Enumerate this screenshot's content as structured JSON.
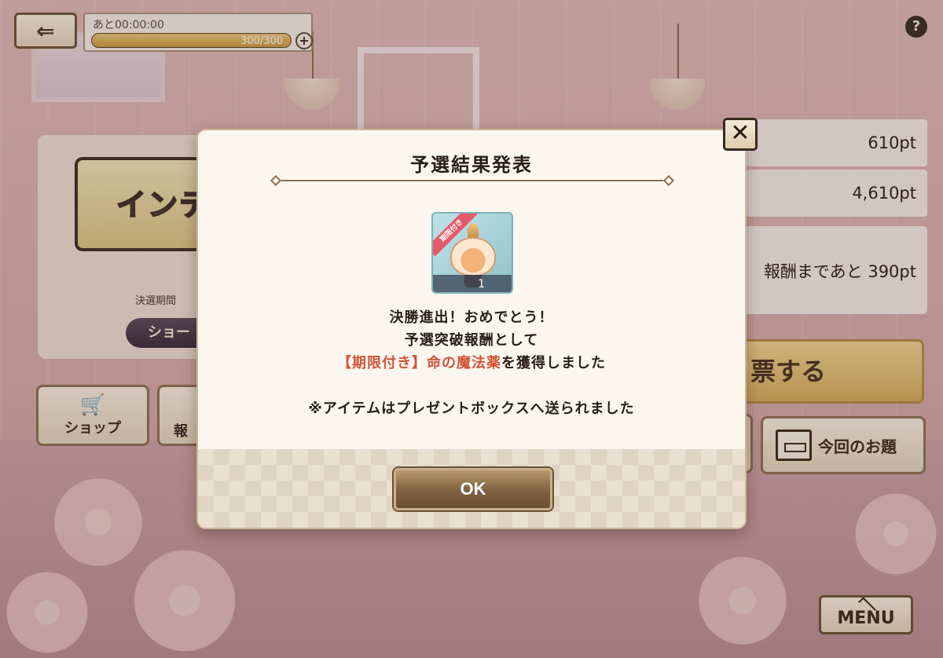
{
  "header": {
    "back_icon": "back-arrow-icon",
    "timer_label": "あと00:00:00",
    "stamina_text": "300/300",
    "stamina_fraction": 1.0,
    "plus_label": "+",
    "help_label": "?"
  },
  "event": {
    "logo_text": "インテ",
    "final_period_label": "決選期間",
    "show_button_label": "ショー"
  },
  "bottom_left": {
    "shop_label": "ショップ",
    "shop_icon": "cart-icon",
    "reward_label": "報"
  },
  "right_panel": {
    "points_1": "610pt",
    "points_2": "4,610pt",
    "remaining_text": "報酬まであと 390pt",
    "vote_label": "票する",
    "theme_label": "今回のお題",
    "theme_icon": "signboard-icon"
  },
  "menu_label": "MENU",
  "dialog": {
    "title": "予選結果発表",
    "close_label": "✕",
    "item": {
      "ribbon_label": "期限付き",
      "count": "1"
    },
    "message_1": "決勝進出！おめでとう！",
    "message_2": "予選突破報酬として",
    "message_3_highlight": "【期限付き】命の魔法薬",
    "message_3_rest": "を獲得しました",
    "message_4": "※アイテムはプレゼントボックスへ送られました",
    "ok_label": "OK"
  },
  "colors": {
    "highlight": "#d0543a",
    "dialog_bg": "#fbf7ef",
    "ok_button": "#7d6140"
  }
}
